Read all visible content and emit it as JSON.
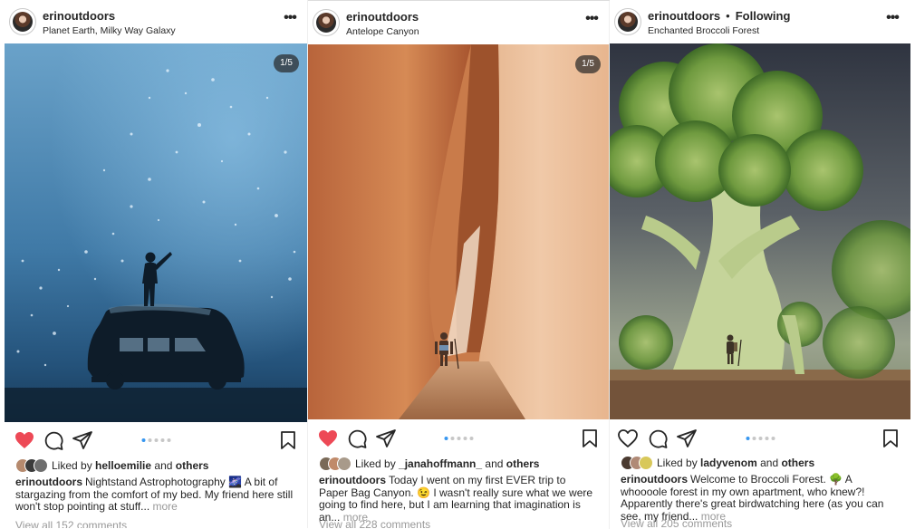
{
  "posts": [
    {
      "username": "erinoutdoors",
      "location": "Planet Earth, Milky Way Galaxy",
      "more_icon": "more-horizontal-icon",
      "counter": "1/5",
      "liked": true,
      "liked_prefix": "Liked by",
      "liked_user": "helloemilie",
      "liked_and": "and",
      "liked_others": "others",
      "caption_text": "Nightstand Astrophotography 🌌 A bit of stargazing from the comfort of my bed. My friend here still won't stop pointing at stuff...",
      "more_label": "more",
      "view_all": "View all 152 comments",
      "carousel_total": 5,
      "carousel_active": 1
    },
    {
      "username": "erinoutdoors",
      "location": "Antelope Canyon",
      "more_icon": "more-horizontal-icon",
      "counter": "1/5",
      "liked": true,
      "liked_prefix": "Liked by",
      "liked_user": "_janahoffmann_",
      "liked_and": "and",
      "liked_others": "others",
      "caption_text": "Today I went on my first EVER trip to Paper Bag Canyon. 😉 I wasn't really sure what we were going to find here, but I am learning that imagination is an...",
      "more_label": "more",
      "view_all": "View all 228 comments",
      "carousel_total": 5,
      "carousel_active": 1
    },
    {
      "username": "erinoutdoors",
      "following_sep": "•",
      "following": "Following",
      "location": "Enchanted Broccoli Forest",
      "more_icon": "more-horizontal-icon",
      "liked": false,
      "liked_prefix": "Liked by",
      "liked_user": "ladyvenom",
      "liked_and": "and",
      "liked_others": "others",
      "caption_text": "Welcome to Broccoli Forest. 🌳 A whoooole forest in my own apartment, who knew?! Apparently there's great birdwatching here (as you can see, my friend...",
      "more_label": "more",
      "view_all": "View all 205 comments",
      "carousel_total": 5,
      "carousel_active": 1
    }
  ],
  "colors": {
    "heart_red": "#ed4956",
    "active_dot": "#3897f0",
    "inactive_dot": "#c7c7c7",
    "text": "#262626",
    "muted": "#999999"
  },
  "icons": {
    "like": "heart-icon",
    "comment": "comment-icon",
    "share": "paper-plane-icon",
    "save": "bookmark-icon"
  }
}
